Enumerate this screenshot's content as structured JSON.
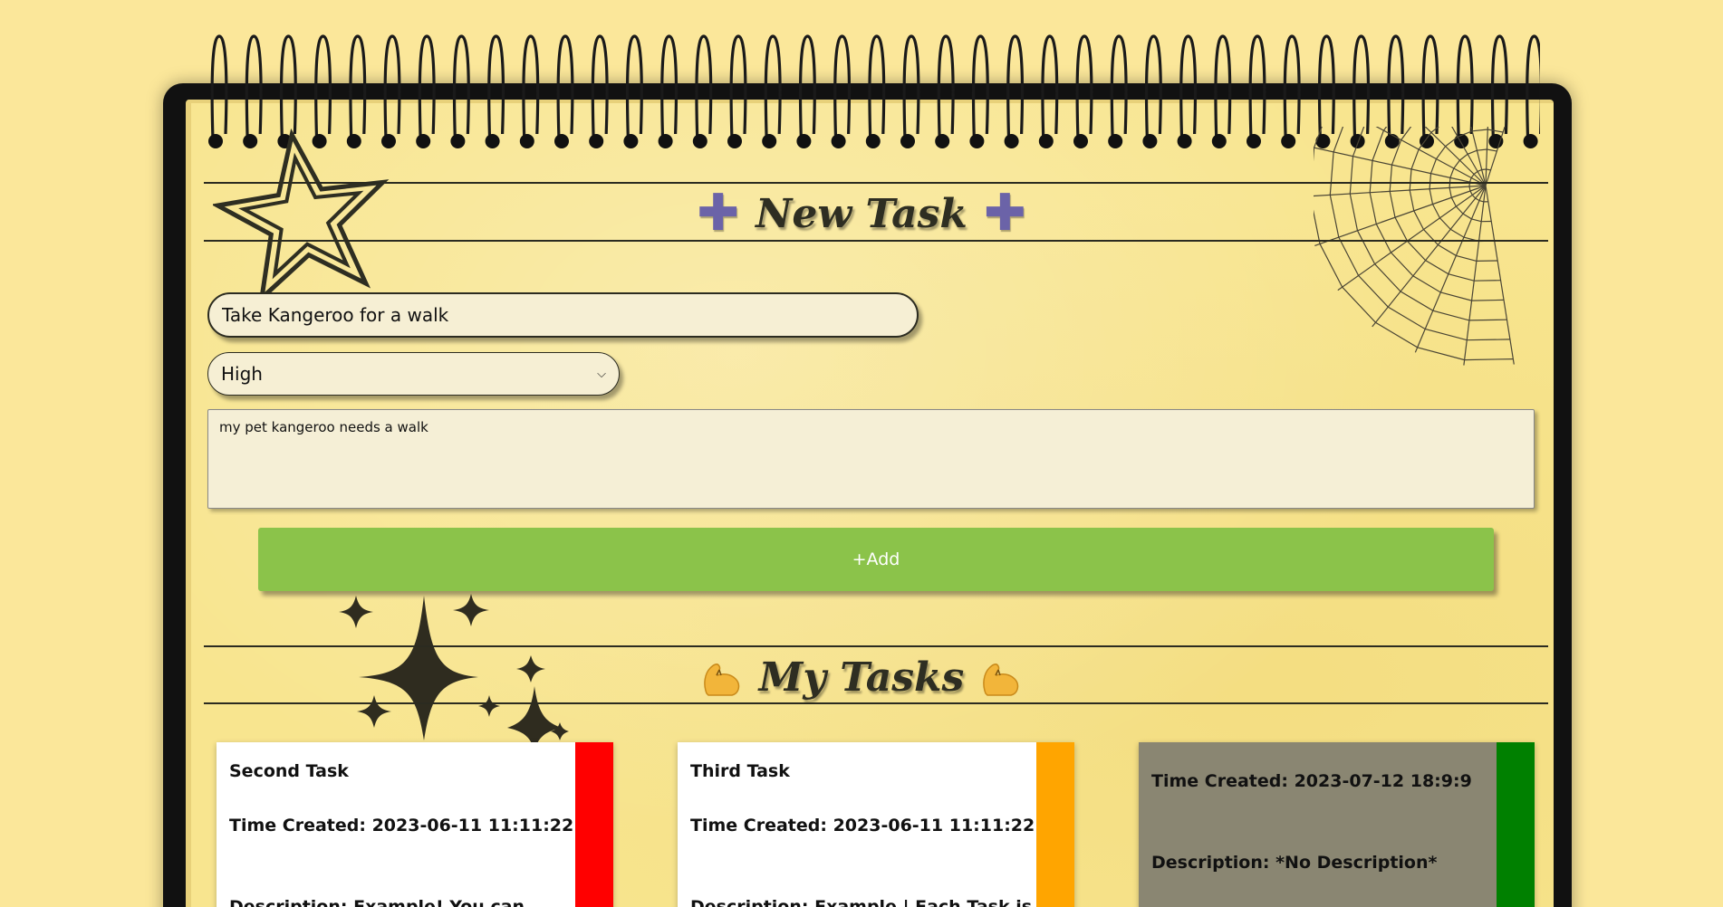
{
  "form": {
    "title": "New Task",
    "task_name_value": "Take Kangeroo for a walk",
    "priority_value": "High",
    "description_value": "my pet kangeroo needs a walk",
    "add_label": "+Add"
  },
  "tasks_section": {
    "title": "My Tasks"
  },
  "tasks": [
    {
      "name": "Second Task",
      "time_created": "Time Created: 2023-06-11 11:11:22",
      "description": "Description: Example! You can",
      "priority_color": "#ff0000"
    },
    {
      "name": "Third Task",
      "time_created": "Time Created: 2023-06-11 11:11:22",
      "description": "Description: Example | Each Task is",
      "priority_color": "#ffa500"
    },
    {
      "name": "",
      "time_created": "Time Created: 2023-07-12 18:9:9",
      "description": "Description: *No Description*",
      "priority_color": "#008000"
    }
  ],
  "colors": {
    "background": "#fbe79a",
    "paper": "#f8e58f",
    "add_button": "#8bc34a",
    "plus_icon": "#6b63a8",
    "completed_card": "#8a8672"
  },
  "icons": [
    "plus-icon",
    "flexed-biceps-icon",
    "star-icon",
    "sparkle-icon",
    "spider-web-icon"
  ]
}
